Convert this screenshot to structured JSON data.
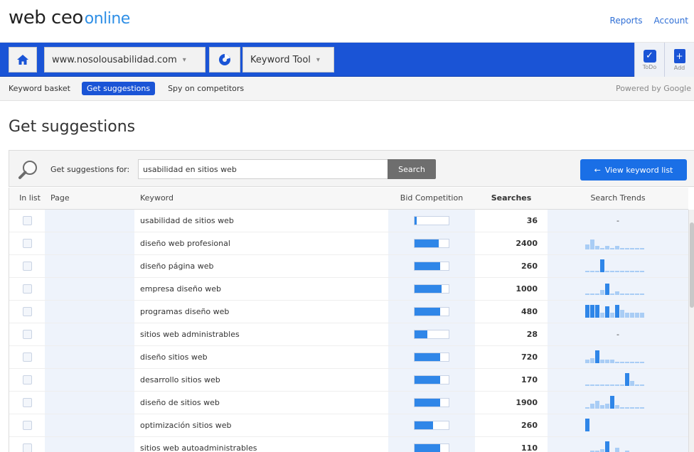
{
  "header": {
    "brand_main": "web ceo",
    "brand_suffix": "online",
    "links": [
      "Reports",
      "Account"
    ]
  },
  "nav": {
    "site": "www.nosolousabilidad.com",
    "tool": "Keyword Tool",
    "right_buttons": [
      {
        "label": "ToDo",
        "icon": "checkbox-icon"
      },
      {
        "label": "Add",
        "icon": "add-document-icon"
      }
    ]
  },
  "subnav": {
    "items": [
      "Keyword basket",
      "Get suggestions",
      "Spy on competitors"
    ],
    "active": "Get suggestions",
    "powered_by": "Powered by Google"
  },
  "page": {
    "title": "Get suggestions"
  },
  "search": {
    "label": "Get suggestions for:",
    "value": "usabilidad en sitios web",
    "button": "Search",
    "view_list_button": "View keyword list"
  },
  "table": {
    "columns": [
      "In list",
      "Page",
      "Keyword",
      "Bid Competition",
      "Searches",
      "Search Trends"
    ],
    "rows": [
      {
        "keyword": "usabilidad de sitios web",
        "bid": 0.06,
        "searches": "36",
        "trend": null
      },
      {
        "keyword": "diseño web profesional",
        "bid": 0.7,
        "searches": "2400",
        "trend": [
          3,
          6,
          2,
          1,
          2,
          1,
          2,
          1,
          1,
          1,
          1,
          1
        ]
      },
      {
        "keyword": "diseño página web",
        "bid": 0.75,
        "searches": "260",
        "trend": [
          1,
          1,
          1,
          8,
          1,
          1,
          1,
          1,
          1,
          1,
          1,
          1
        ]
      },
      {
        "keyword": "empresa diseño web",
        "bid": 0.8,
        "searches": "1000",
        "trend": [
          1,
          1,
          1,
          3,
          7,
          1,
          2,
          1,
          1,
          1,
          1,
          1
        ]
      },
      {
        "keyword": "programas diseño web",
        "bid": 0.74,
        "searches": "480",
        "trend": [
          8,
          8,
          8,
          3,
          7,
          3,
          8,
          5,
          3,
          3,
          3,
          3
        ]
      },
      {
        "keyword": "sitios web administrables",
        "bid": 0.38,
        "searches": "28",
        "trend": null
      },
      {
        "keyword": "diseño sitios web",
        "bid": 0.74,
        "searches": "720",
        "trend": [
          2,
          3,
          8,
          2,
          2,
          2,
          1,
          1,
          1,
          1,
          1,
          1
        ]
      },
      {
        "keyword": "desarrollo sitios web",
        "bid": 0.74,
        "searches": "170",
        "trend": [
          1,
          1,
          1,
          1,
          1,
          1,
          1,
          1,
          8,
          3,
          1,
          1
        ]
      },
      {
        "keyword": "diseño de sitios web",
        "bid": 0.74,
        "searches": "1900",
        "trend": [
          1,
          3,
          5,
          2,
          3,
          8,
          2,
          1,
          1,
          1,
          1,
          1
        ]
      },
      {
        "keyword": "optimización sitios web",
        "bid": 0.55,
        "searches": "260",
        "trend": [
          8
        ]
      },
      {
        "keyword": "sitios web autoadministrables",
        "bid": 0.74,
        "searches": "110",
        "trend": [
          1,
          2,
          2,
          3,
          8,
          1,
          4,
          1,
          2,
          1,
          1,
          1
        ]
      }
    ]
  },
  "colors": {
    "nav_blue": "#1a54d6",
    "accent_blue": "#2f86e8",
    "trend_light": "#a9cdf5"
  }
}
